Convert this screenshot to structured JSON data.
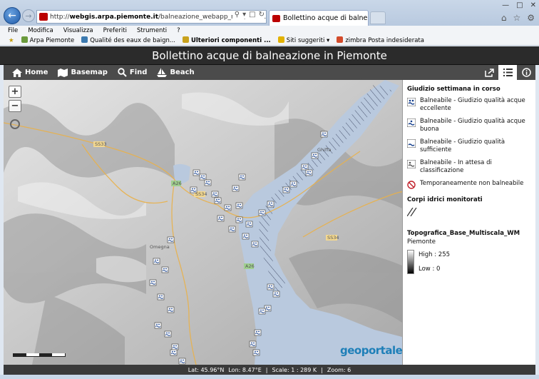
{
  "browser": {
    "address": {
      "prefix": "http://",
      "host": "webgis.arpa.piemonte.it",
      "path": "/balneazione_webapp_new/index.php?webmap=f"
    },
    "tab_label": "Bollettino acque di balnea...",
    "menu": [
      "File",
      "Modifica",
      "Visualizza",
      "Preferiti",
      "Strumenti",
      "?"
    ],
    "favorites": [
      "Arpa Piemonte",
      "Qualité des eaux de baign...",
      "Ulteriori componenti ...",
      "Siti suggeriti",
      "zimbra Posta indesiderata"
    ]
  },
  "app": {
    "title": "Bollettino acque di balneazione in Piemonte",
    "toolbar": {
      "home": "Home",
      "basemap": "Basemap",
      "find": "Find",
      "beach": "Beach"
    }
  },
  "map": {
    "zoom_in": "+",
    "zoom_out": "−",
    "labels": [
      "SS33",
      "A26",
      "SS34",
      "Ghiffa",
      "Omegna",
      "A26",
      "SS34"
    ],
    "watermark": "geoportale"
  },
  "legend": {
    "section1_title": "Giudizio settimana in corso",
    "items": [
      {
        "label": "Balneabile - Giudizio qualità acque eccellente",
        "icon": "swim-excellent-icon"
      },
      {
        "label": "Balneabile - Giudizio qualità acque buona",
        "icon": "swim-good-icon"
      },
      {
        "label": "Balneabile - Giudizio qualità sufficiente",
        "icon": "swim-sufficient-icon"
      },
      {
        "label": "Balneabile - In attesa di classificazione",
        "icon": "swim-pending-icon"
      },
      {
        "label": "Temporaneamente non balneabile",
        "icon": "no-swim-icon"
      }
    ],
    "section2_title": "Corpi idrici monitorati",
    "section3_title": "Topografica_Base_Multiscala_WM",
    "section3_sub": "Piemonte",
    "high": "High : 255",
    "low": "Low : 0"
  },
  "status": {
    "lat": "Lat: 45.96°N",
    "lon": "Lon: 8.47°E",
    "scale": "Scale: 1 : 289 K",
    "zoom": "Zoom: 6"
  },
  "colors": {
    "app_header": "#2b2b2b",
    "toolbar": "#4b4b4b",
    "lake": "#b9c9de",
    "accent": "#1e7fb8"
  }
}
